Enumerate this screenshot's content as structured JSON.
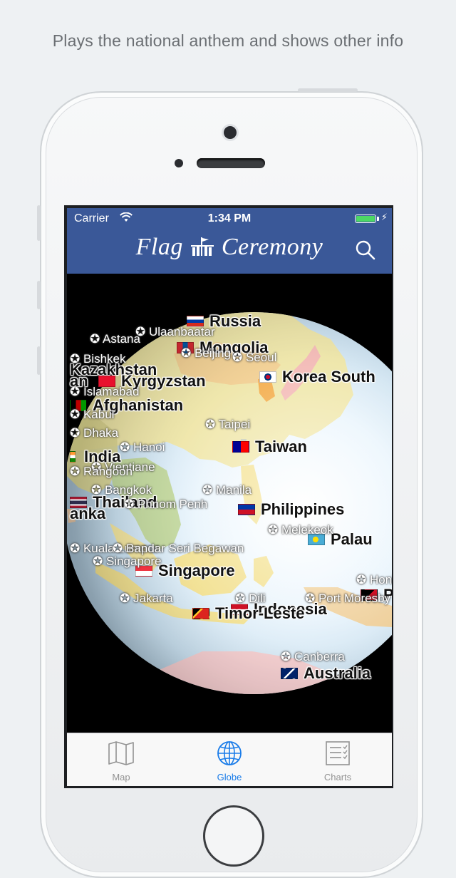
{
  "caption": "Plays the national anthem and shows other info",
  "status_bar": {
    "carrier": "Carrier",
    "time": "1:34 PM"
  },
  "nav": {
    "title_left": "Flag",
    "title_right": "Ceremony"
  },
  "colors": {
    "nav_bg": "#3a5898",
    "tab_active": "#1a7ce9",
    "tab_inactive": "#929292",
    "battery": "#4cd964"
  },
  "globe": {
    "countries": [
      {
        "name": "Russia"
      },
      {
        "name": "Mongolia"
      },
      {
        "name": "Kazakhstan"
      },
      {
        "name": "Kyrgyzstan"
      },
      {
        "name": "Korea South"
      },
      {
        "name": "Afghanistan"
      },
      {
        "name": "Taiwan"
      },
      {
        "name": "India"
      },
      {
        "name": "Thailand"
      },
      {
        "name": "Philippines"
      },
      {
        "name": "Palau"
      },
      {
        "name": "Singapore"
      },
      {
        "name": "Timor-Leste"
      },
      {
        "name": "Indonesia"
      },
      {
        "name": "Australia"
      },
      {
        "name": "anka"
      },
      {
        "name": "an"
      },
      {
        "name": "P"
      }
    ],
    "capitals": [
      {
        "name": "Astana"
      },
      {
        "name": "Ulaanbaatar"
      },
      {
        "name": "Bishkek"
      },
      {
        "name": "Beijing"
      },
      {
        "name": "Seoul"
      },
      {
        "name": "Islamabad"
      },
      {
        "name": "Kabul"
      },
      {
        "name": "Taipei"
      },
      {
        "name": "Dhaka"
      },
      {
        "name": "Hanoi"
      },
      {
        "name": "Vientiane"
      },
      {
        "name": "Rangoon"
      },
      {
        "name": "Bangkok"
      },
      {
        "name": "Phnom Penh"
      },
      {
        "name": "Manila"
      },
      {
        "name": "Melekeok"
      },
      {
        "name": "Kuala Lumpur"
      },
      {
        "name": "Bandar Seri Begawan"
      },
      {
        "name": "Singapore"
      },
      {
        "name": "Jakarta"
      },
      {
        "name": "Dili"
      },
      {
        "name": "Port Moresby"
      },
      {
        "name": "Canberra"
      },
      {
        "name": "Honiara"
      }
    ]
  },
  "tabs": [
    {
      "label": "Map",
      "icon": "map-icon",
      "active": false
    },
    {
      "label": "Globe",
      "icon": "globe-icon",
      "active": true
    },
    {
      "label": "Charts",
      "icon": "charts-icon",
      "active": false
    }
  ]
}
